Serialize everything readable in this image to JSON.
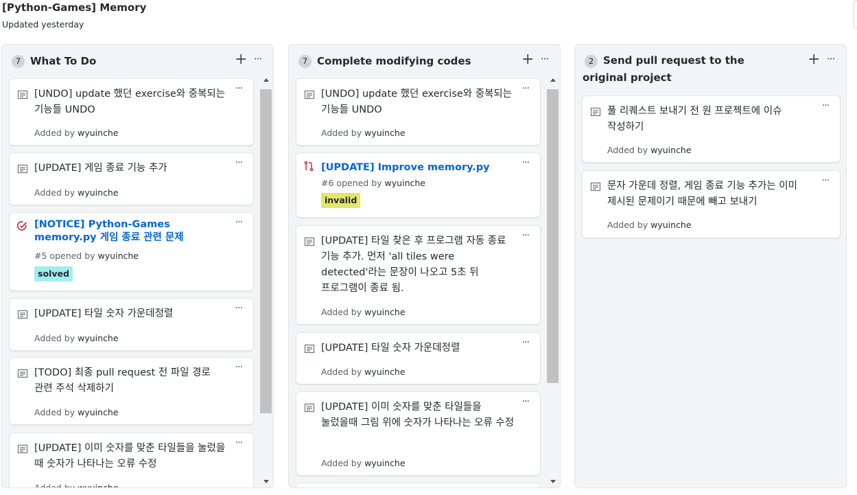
{
  "project": {
    "title": "[Python-Games] Memory",
    "updated": "Updated yesterday"
  },
  "columns": [
    {
      "count": "7",
      "name": "What To Do",
      "cards": [
        {
          "type": "note",
          "text": "[UNDO] update 했던 exercise와 중복되는 기능들 UNDO",
          "added_prefix": "Added by",
          "author": "wyuinche"
        },
        {
          "type": "note",
          "text": "[UPDATE] 게임 종료 기능 추가",
          "added_prefix": "Added by",
          "author": "wyuinche"
        },
        {
          "type": "issue",
          "icon": "issue-closed-icon",
          "title": "[NOTICE] Python-Games memory.py 게임 종료 관련 문제",
          "number": "#5",
          "opened_text": "opened by",
          "author": "wyuinche",
          "label": "solved",
          "label_color": "#a2eeef"
        },
        {
          "type": "note",
          "text": "[UPDATE] 타일 숫자 가운데정렬",
          "added_prefix": "Added by",
          "author": "wyuinche"
        },
        {
          "type": "note",
          "text": "[TODO] 최종 pull request 전 파일 경로 관련 주석 삭제하기",
          "added_prefix": "Added by",
          "author": "wyuinche"
        },
        {
          "type": "note",
          "text": "[UPDATE] 이미 숫자를 맞춘 타일들을 눌렀을 때 숫자가 나타나는 오류 수정",
          "added_prefix": "Added by",
          "author": "wyuinche"
        }
      ]
    },
    {
      "count": "7",
      "name": "Complete modifying codes",
      "cards": [
        {
          "type": "note",
          "text": "[UNDO] update 했던 exercise와 중복되는 기능들 UNDO",
          "added_prefix": "Added by",
          "author": "wyuinche"
        },
        {
          "type": "issue",
          "icon": "pull-request-closed-icon",
          "title": "[UPDATE] Improve memory.py",
          "number": "#6",
          "opened_text": "opened by",
          "author": "wyuinche",
          "label": "invalid",
          "label_color": "#e4e669"
        },
        {
          "type": "note",
          "text": "[UPDATE] 타일 찾은 후 프로그램 자동 종료 기능 추가. 먼저 'all tiles were detected'라는 문장이 나오고 5초 뒤 프로그램이 종료 됨.",
          "added_prefix": "Added by",
          "author": "wyuinche"
        },
        {
          "type": "note",
          "text": "[UPDATE] 타일 숫자 가운데정렬",
          "added_prefix": "Added by",
          "author": "wyuinche"
        },
        {
          "type": "note",
          "text": "[UPDATE] 이미 숫자를 맞춘 타일들을 눌렀을때 그림 위에 숫자가 나타나는 오류 수정",
          "added_prefix": "Added by",
          "author": "wyuinche"
        }
      ]
    },
    {
      "count": "2",
      "name": "Send pull request to the original project",
      "cards": [
        {
          "type": "note",
          "text": "풀 리퀘스트 보내기 전 원 프로젝트에 이슈 작성하기",
          "added_prefix": "Added by",
          "author": "wyuinche"
        },
        {
          "type": "note",
          "text": "문자 가운데 정렬, 게임 종료 기능 추가는 이미 제시된 문제이기 때문에 빼고 보내기",
          "added_prefix": "Added by",
          "author": "wyuinche"
        }
      ]
    }
  ],
  "icons": {
    "add": "plus-icon",
    "more": "kebab-horizontal-icon",
    "note": "note-icon"
  },
  "controls": {
    "add_glyph": "+",
    "more_glyph": "···"
  }
}
